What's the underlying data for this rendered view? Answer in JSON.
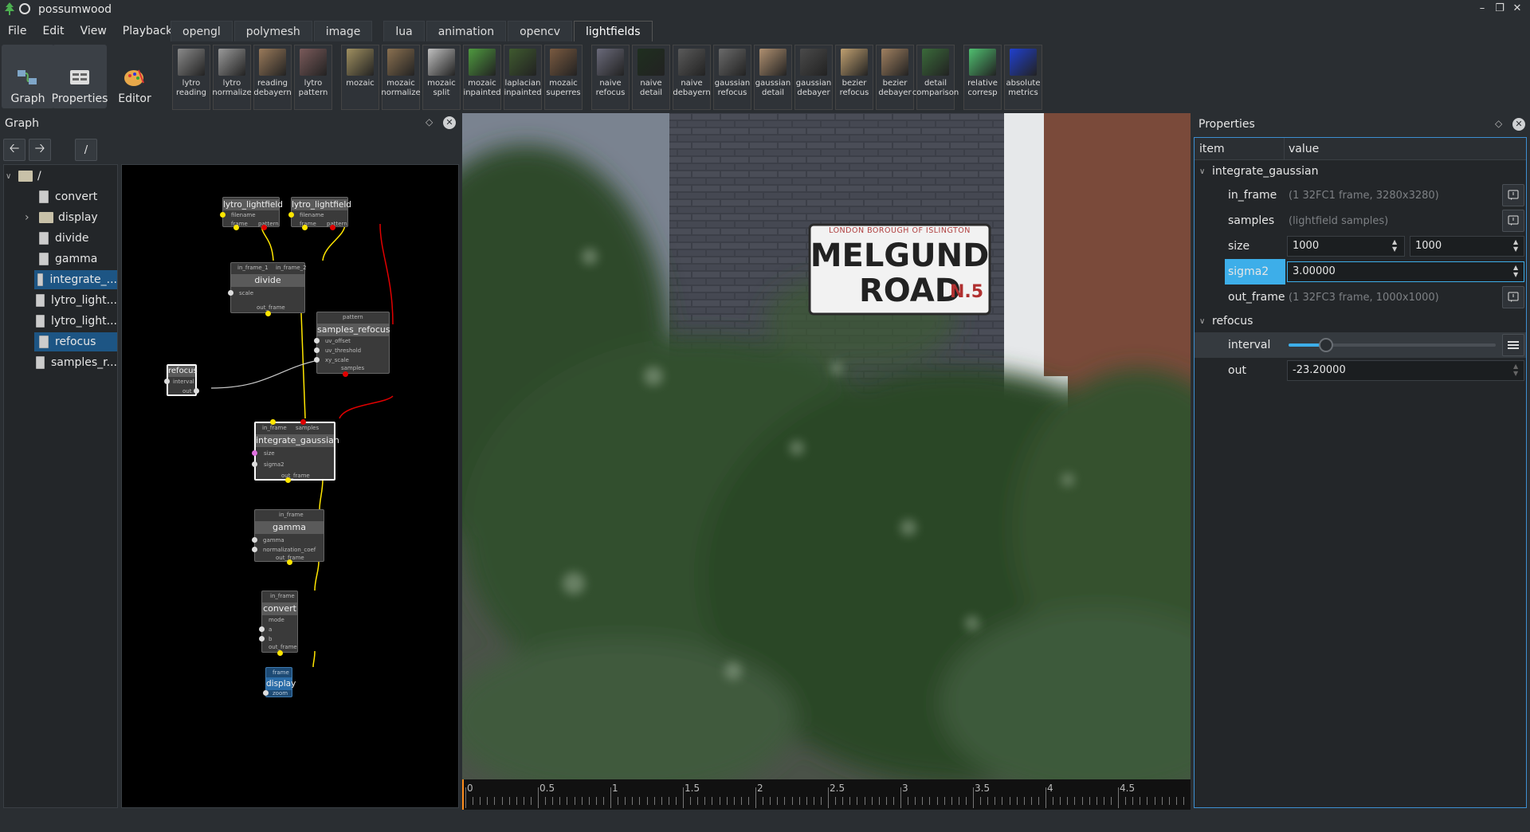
{
  "window": {
    "title": "possumwood"
  },
  "menu": [
    "File",
    "Edit",
    "View",
    "Playback"
  ],
  "tabs": [
    "opengl",
    "polymesh",
    "image",
    "lua",
    "animation",
    "opencv",
    "lightfields"
  ],
  "active_tab": "lightfields",
  "modes": [
    {
      "label": "Graph",
      "icon": "graph-icon",
      "selected": true
    },
    {
      "label": "Properties",
      "icon": "properties-icon",
      "selected": true
    },
    {
      "label": "Editor",
      "icon": "editor-icon",
      "selected": false
    }
  ],
  "tools": [
    {
      "label": "lytro\nreading",
      "color": "#8a8a8a"
    },
    {
      "label": "lytro\nnormalize",
      "color": "#9a9a9a"
    },
    {
      "label": "reading\ndebayern",
      "color": "#9a7a5a"
    },
    {
      "label": "lytro\npattern",
      "color": "#7a5a5a"
    },
    {
      "label": "mozaic",
      "color": "#a09060"
    },
    {
      "label": "mozaic\nnormalize",
      "color": "#8a7050"
    },
    {
      "label": "mozaic\nsplit",
      "color": "#c0c0c0"
    },
    {
      "label": "mozaic\ninpainted",
      "color": "#4f9a3f"
    },
    {
      "label": "laplacian\ninpainted",
      "color": "#3f5a2f"
    },
    {
      "label": "mozaic\nsuperres",
      "color": "#7a5a40"
    },
    {
      "label": "naive\nrefocus",
      "color": "#6a6a7a"
    },
    {
      "label": "naive\ndetail",
      "color": "#1f2f1f"
    },
    {
      "label": "naive\ndebayern",
      "color": "#5a5a5a"
    },
    {
      "label": "gaussian\nrefocus",
      "color": "#6a6a6a"
    },
    {
      "label": "gaussian\ndetail",
      "color": "#b09070"
    },
    {
      "label": "gaussian\ndebayer",
      "color": "#4a4a4a"
    },
    {
      "label": "bezier\nrefocus",
      "color": "#c0a070"
    },
    {
      "label": "bezier\ndebayer",
      "color": "#a08060"
    },
    {
      "label": "detail\ncomparison",
      "color": "#3a6a3a"
    },
    {
      "label": "relative\ncorresp",
      "color": "#50c070"
    },
    {
      "label": "absolute\nmetrics",
      "color": "#2040d0"
    }
  ],
  "graph_panel": {
    "title": "Graph",
    "path": "/"
  },
  "tree": {
    "root": "/",
    "items": [
      {
        "label": "convert",
        "selected": false,
        "folder": false
      },
      {
        "label": "display",
        "selected": false,
        "folder": true
      },
      {
        "label": "divide",
        "selected": false,
        "folder": false
      },
      {
        "label": "gamma",
        "selected": false,
        "folder": false
      },
      {
        "label": "integrate_...",
        "selected": true,
        "folder": false
      },
      {
        "label": "lytro_light...",
        "selected": false,
        "folder": false
      },
      {
        "label": "lytro_light...",
        "selected": false,
        "folder": false
      },
      {
        "label": "refocus",
        "selected": true,
        "folder": false
      },
      {
        "label": "samples_r...",
        "selected": false,
        "folder": false
      }
    ]
  },
  "nodes": {
    "lytro1": {
      "title": "lytro_lightfield",
      "ports": [
        "filename",
        "frame",
        "pattern"
      ]
    },
    "lytro2": {
      "title": "lytro_lightfield",
      "ports": [
        "filename",
        "frame",
        "pattern"
      ]
    },
    "divide": {
      "title": "divide",
      "ports": [
        "in_frame_1",
        "in_frame_2",
        "scale",
        "out_frame"
      ]
    },
    "samples_refocus": {
      "title": "samples_refocus",
      "ports": [
        "pattern",
        "uv_offset",
        "uv_threshold",
        "xy_scale",
        "samples"
      ]
    },
    "refocus": {
      "title": "refocus",
      "ports": [
        "interval",
        "out"
      ]
    },
    "integrate": {
      "title": "integrate_gaussian",
      "ports": [
        "in_frame",
        "samples",
        "size",
        "sigma2",
        "out_frame"
      ]
    },
    "gamma": {
      "title": "gamma",
      "ports": [
        "in_frame",
        "gamma",
        "normalization_coef",
        "out_frame"
      ]
    },
    "convert": {
      "title": "convert",
      "ports": [
        "in_frame",
        "mode",
        "a",
        "b",
        "out_frame"
      ]
    },
    "display": {
      "title": "display",
      "ports": [
        "frame",
        "zoom"
      ]
    }
  },
  "viewport": {
    "sign_line1": "LONDON BOROUGH OF ISLINGTON",
    "sign_line2": "MELGUND",
    "sign_line3": "ROAD",
    "sign_district": "N.5"
  },
  "timeline": {
    "ticks": [
      "0",
      "0.5",
      "1",
      "1.5",
      "2",
      "2.5",
      "3",
      "3.5",
      "4",
      "4.5"
    ]
  },
  "properties": {
    "title": "Properties",
    "col_item": "item",
    "col_value": "value",
    "group1": "integrate_gaussian",
    "in_frame_label": "in_frame",
    "in_frame_value": "(1 32FC1 frame, 3280x3280)",
    "samples_label": "samples",
    "samples_value": "(lightfield samples)",
    "size_label": "size",
    "size_w": "1000",
    "size_h": "1000",
    "sigma2_label": "sigma2",
    "sigma2_value": "3.00000",
    "out_frame_label": "out_frame",
    "out_frame_value": "(1 32FC3 frame, 1000x1000)",
    "group2": "refocus",
    "interval_label": "interval",
    "interval_fraction": 0.18,
    "out_label": "out",
    "out_value": "-23.20000"
  },
  "colors": {
    "accent": "#3daee9",
    "selection": "#1d5584",
    "link_yellow": "#ffe600",
    "link_red": "#d00000"
  }
}
